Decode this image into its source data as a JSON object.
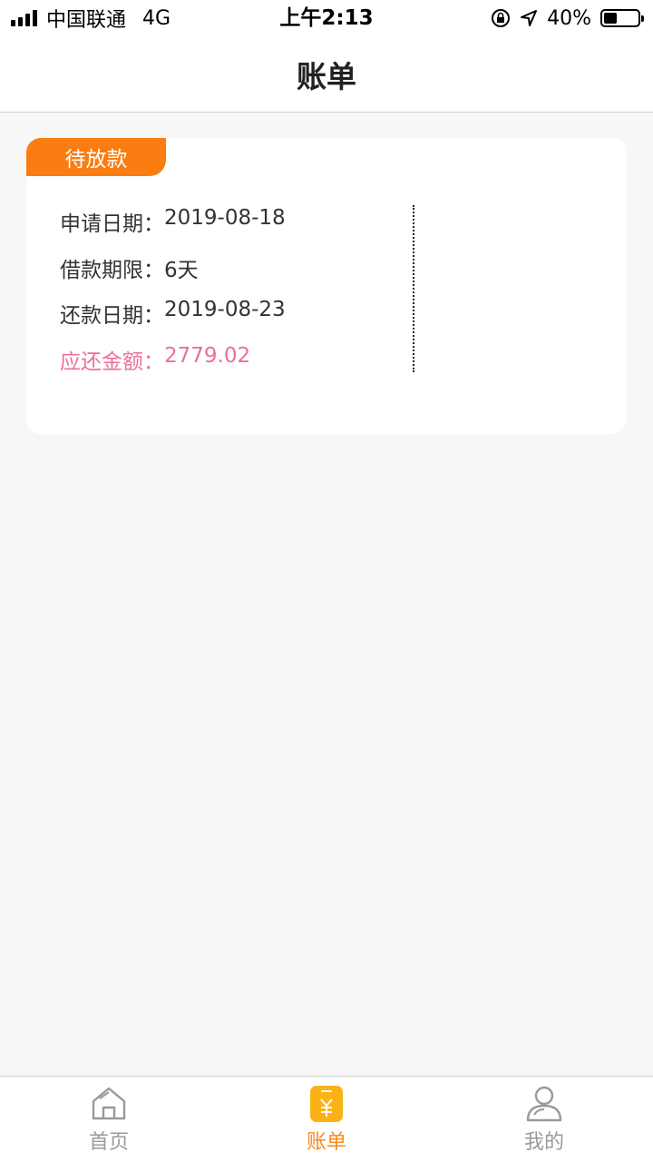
{
  "status_bar": {
    "carrier": "中国联通",
    "network": "4G",
    "time": "上午2:13",
    "battery_percent": "40%",
    "battery_level": 0.4
  },
  "header": {
    "title": "账单"
  },
  "bill": {
    "status_tag": "待放款",
    "rows": [
      {
        "label": "申请日期：",
        "value": "2019-08-18"
      },
      {
        "label": "借款期限：",
        "value": "6天"
      },
      {
        "label": "还款日期：",
        "value": "2019-08-23"
      },
      {
        "label": "应还金额：",
        "value": "2779.02"
      }
    ],
    "highlight_color": "#ec6f9d",
    "tag_color": "#fb7c10"
  },
  "tab_bar": {
    "active_color": "#f58a1f",
    "tabs": [
      {
        "label": "首页",
        "icon": "home-icon",
        "active": false
      },
      {
        "label": "账单",
        "icon": "bill-icon",
        "active": true
      },
      {
        "label": "我的",
        "icon": "profile-icon",
        "active": false
      }
    ]
  }
}
